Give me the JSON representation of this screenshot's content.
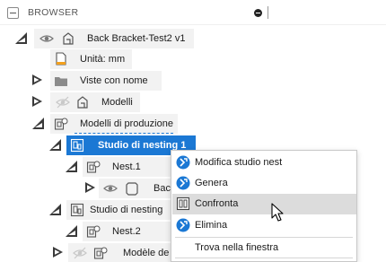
{
  "header": {
    "title": "BROWSER"
  },
  "tree": {
    "root": {
      "label": "Back Bracket-Test2 v1"
    },
    "units": {
      "label": "Unità: mm"
    },
    "named_views": {
      "label": "Viste con nome"
    },
    "models": {
      "label": "Modelli"
    },
    "production_models": {
      "label": "Modelli di produzione"
    },
    "nesting_study_1": {
      "label": "Studio di nesting 1"
    },
    "nest_1": {
      "label": "Nest.1"
    },
    "nest_1_child": {
      "label": "Bac"
    },
    "nesting_study_2": {
      "label": "Studio di nesting"
    },
    "nest_2": {
      "label": "Nest.2"
    },
    "nest_2_child": {
      "label": "Modèle de"
    }
  },
  "context_menu": {
    "items": [
      {
        "label": "Modifica studio nest",
        "icon": "edit-nest-study-icon"
      },
      {
        "label": "Genera",
        "icon": "generate-icon"
      },
      {
        "label": "Confronta",
        "icon": "compare-icon"
      },
      {
        "label": "Elimina",
        "icon": "delete-icon"
      },
      {
        "label": "Trova nella finestra",
        "icon": ""
      }
    ],
    "hovered_index": 2
  },
  "colors": {
    "selection": "#1b78d4",
    "menu_hover": "#dcdcdc",
    "chip": "#f2f2f2"
  }
}
